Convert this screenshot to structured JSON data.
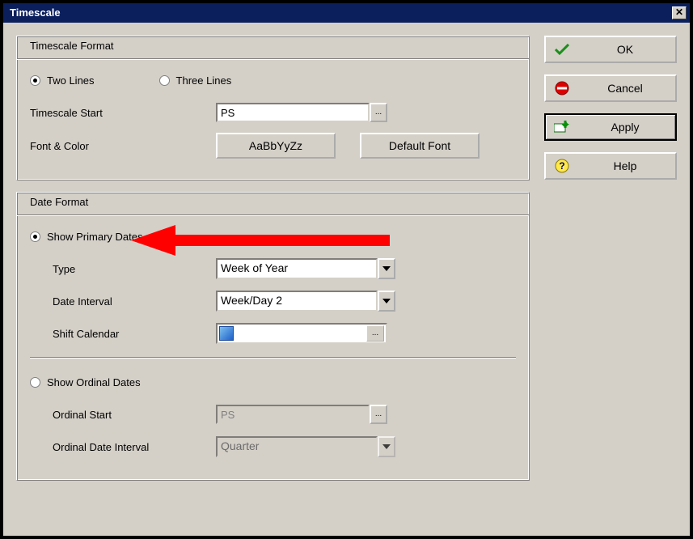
{
  "window": {
    "title": "Timescale"
  },
  "buttons": {
    "ok": "OK",
    "cancel": "Cancel",
    "apply": "Apply",
    "help": "Help",
    "close_glyph": "✕"
  },
  "format_group": {
    "title": "Timescale Format",
    "two_lines": "Two Lines",
    "three_lines": "Three Lines",
    "selected": "two",
    "start_label": "Timescale Start",
    "start_value": "PS",
    "font_label": "Font & Color",
    "font_sample": "AaBbYyZz",
    "default_font": "Default Font",
    "browse_glyph": "..."
  },
  "date_group": {
    "title": "Date Format",
    "primary_label": "Show Primary Dates",
    "ordinal_label": "Show Ordinal Dates",
    "selected": "primary",
    "type_label": "Type",
    "type_value": "Week of Year",
    "interval_label": "Date Interval",
    "interval_value": "Week/Day 2",
    "shift_label": "Shift Calendar",
    "ordinal_start_label": "Ordinal Start",
    "ordinal_start_value": "PS",
    "ordinal_interval_label": "Ordinal Date Interval",
    "ordinal_interval_value": "Quarter",
    "browse_glyph": "..."
  }
}
